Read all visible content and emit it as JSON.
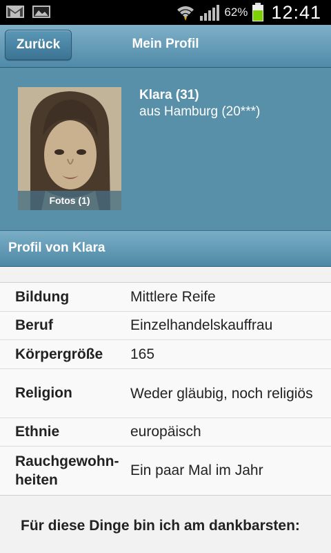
{
  "status_bar": {
    "battery_percent": "62%",
    "time": "12:41",
    "icons": [
      "gmail-icon",
      "gallery-icon",
      "wifi-icon",
      "signal-icon",
      "battery-icon"
    ]
  },
  "header": {
    "back_label": "Zurück",
    "title": "Mein Profil"
  },
  "profile": {
    "name_age": "Klara (31)",
    "location": "aus Hamburg (20***)",
    "photo_caption": "Fotos (1)"
  },
  "section": {
    "title": "Profil von Klara"
  },
  "details": [
    {
      "label": "Bildung",
      "value": "Mittlere Reife"
    },
    {
      "label": "Beruf",
      "value": "Einzelhandelskauffrau"
    },
    {
      "label": "Körpergröße",
      "value": "165"
    },
    {
      "label": "Religion",
      "value": "Weder gläubig, noch religiös"
    },
    {
      "label": "Ethnie",
      "value": "europäisch"
    },
    {
      "label": "Rauchgewohn-heiten",
      "value": "Ein paar Mal im Jahr"
    }
  ],
  "things_heading": "Für diese Dinge bin ich am dankbarsten:",
  "colors": {
    "header": "#5a93b0",
    "profile_bg": "#588fa9",
    "battery": "#7fd000"
  }
}
